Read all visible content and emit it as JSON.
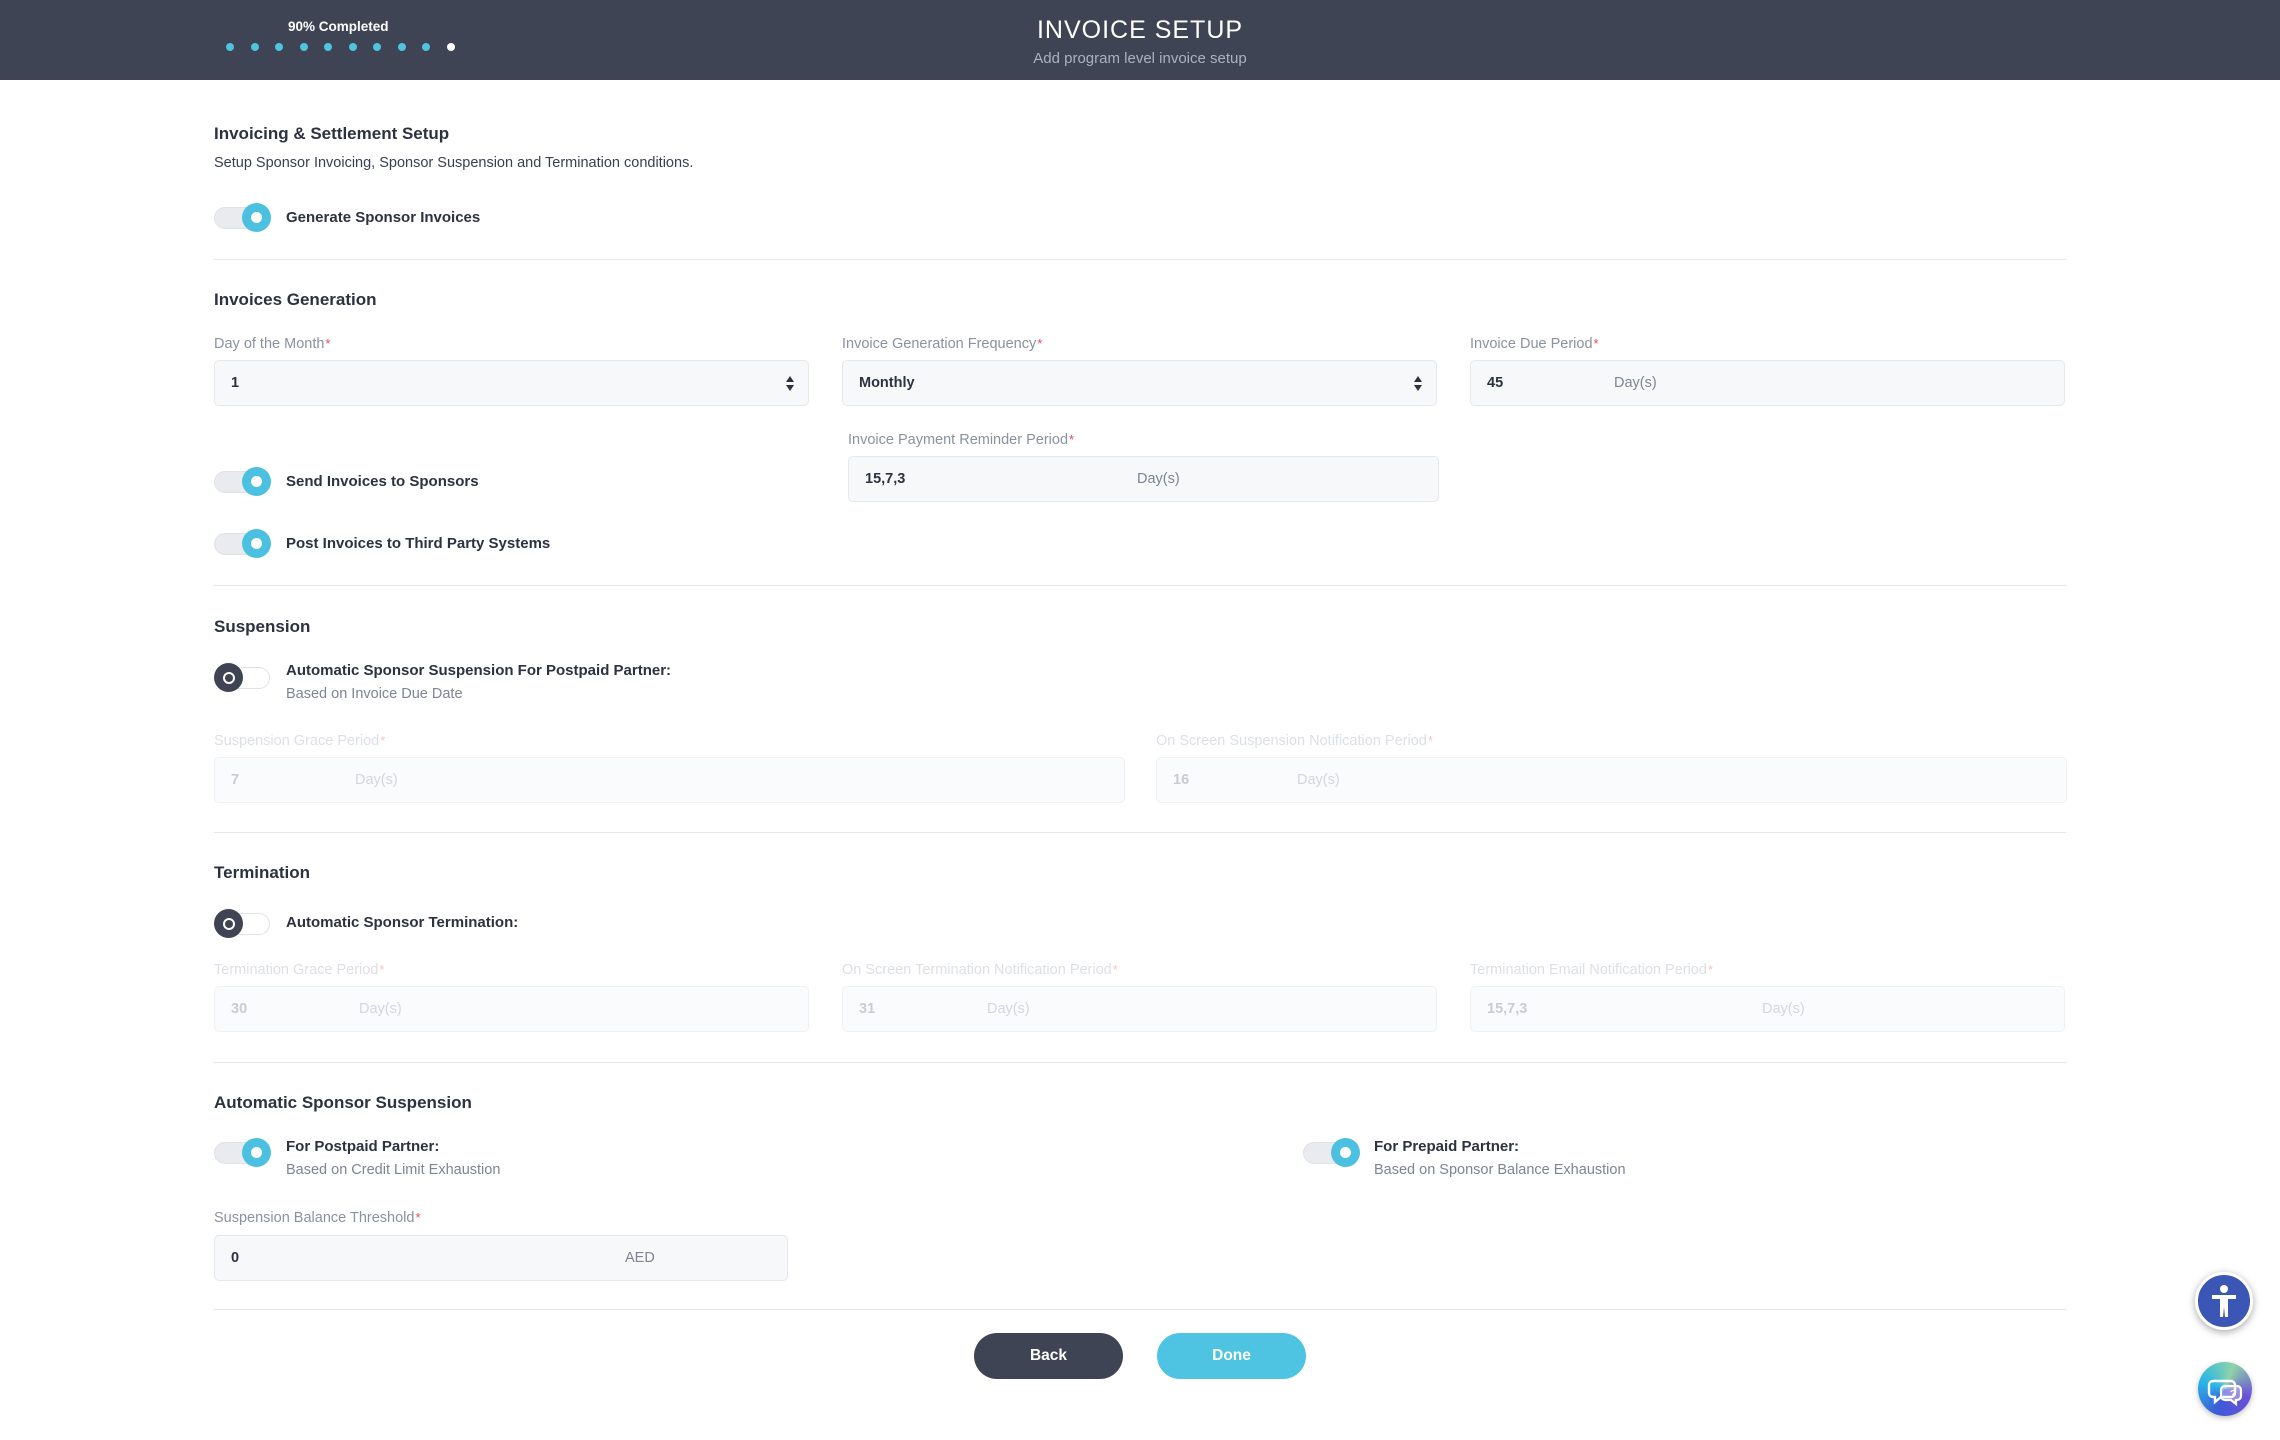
{
  "header": {
    "progress_label": "90% Completed",
    "progress_steps_total": 10,
    "progress_steps_completed": 9,
    "progress_fraction": 0.9,
    "title": "INVOICE SETUP",
    "subtitle": "Add program level invoice setup"
  },
  "invoicing_setup": {
    "title": "Invoicing & Settlement Setup",
    "description": "Setup Sponsor Invoicing, Sponsor Suspension and Termination conditions.",
    "generate_toggle": {
      "label": "Generate Sponsor Invoices",
      "on": true
    }
  },
  "invoices_generation": {
    "title": "Invoices Generation",
    "day_of_month": {
      "label": "Day of the Month",
      "required_mark": "*",
      "value": "1"
    },
    "frequency": {
      "label": "Invoice Generation Frequency",
      "required_mark": "*",
      "value": "Monthly"
    },
    "due_period": {
      "label": "Invoice Due Period",
      "required_mark": "*",
      "value": "45",
      "unit": "Day(s)"
    },
    "reminder_period": {
      "label": "Invoice Payment Reminder Period",
      "required_mark": "*",
      "value": "15,7,3",
      "unit": "Day(s)"
    },
    "send_toggle": {
      "label": "Send Invoices to Sponsors",
      "on": true
    },
    "post_toggle": {
      "label": "Post Invoices to Third Party Systems",
      "on": true
    }
  },
  "suspension": {
    "title": "Suspension",
    "auto_toggle": {
      "label": "Automatic Sponsor Suspension For Postpaid Partner:",
      "sublabel": "Based on Invoice Due Date",
      "on": false
    },
    "grace_period": {
      "label": "Suspension Grace Period",
      "required_mark": "*",
      "value": "7",
      "unit": "Day(s)"
    },
    "notification_period": {
      "label": "On Screen Suspension Notification Period",
      "required_mark": "*",
      "value": "16",
      "unit": "Day(s)"
    }
  },
  "termination": {
    "title": "Termination",
    "auto_toggle": {
      "label": "Automatic Sponsor Termination:",
      "on": false
    },
    "grace_period": {
      "label": "Termination Grace Period",
      "required_mark": "*",
      "value": "30",
      "unit": "Day(s)"
    },
    "screen_notification": {
      "label": "On Screen Termination Notification Period",
      "required_mark": "*",
      "value": "31",
      "unit": "Day(s)"
    },
    "email_notification": {
      "label": "Termination Email Notification Period",
      "required_mark": "*",
      "value": "15,7,3",
      "unit": "Day(s)"
    }
  },
  "auto_suspension": {
    "title": "Automatic Sponsor Suspension",
    "postpaid_toggle": {
      "label": "For Postpaid Partner:",
      "sublabel": "Based on Credit Limit Exhaustion",
      "on": true
    },
    "prepaid_toggle": {
      "label": "For Prepaid Partner:",
      "sublabel": "Based on Sponsor Balance Exhaustion",
      "on": true
    },
    "balance_threshold": {
      "label": "Suspension Balance Threshold",
      "required_mark": "*",
      "value": "0",
      "unit": "AED"
    }
  },
  "actions": {
    "back_label": "Back",
    "done_label": "Done"
  },
  "floating": {
    "accessibility_icon": "accessibility-icon",
    "chat_icon": "chat-icon"
  },
  "colors": {
    "header_bg": "#3e4454",
    "accent": "#4fc3e2",
    "required": "#e5484d"
  }
}
